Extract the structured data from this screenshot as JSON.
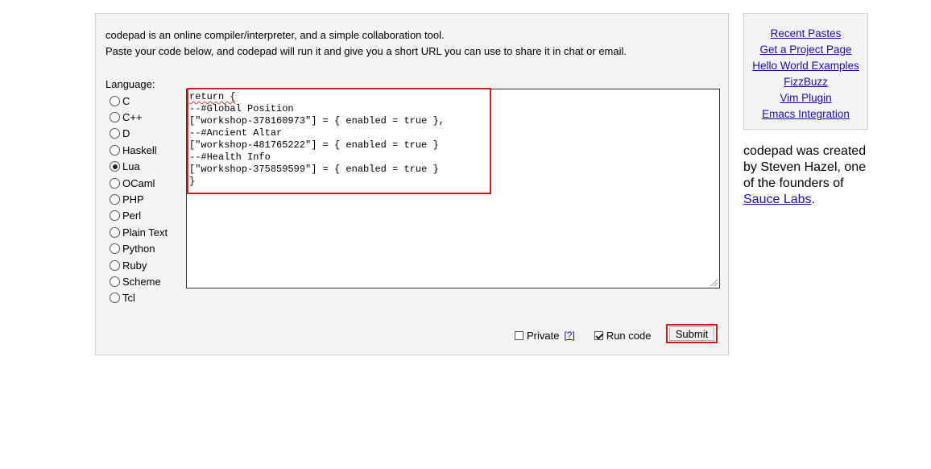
{
  "intro": {
    "line1": "codepad is an online compiler/interpreter, and a simple collaboration tool.",
    "line2": "Paste your code below, and codepad will run it and give you a short URL you can use to share it in chat or email."
  },
  "language": {
    "label": "Language:",
    "options": [
      "C",
      "C++",
      "D",
      "Haskell",
      "Lua",
      "OCaml",
      "PHP",
      "Perl",
      "Plain Text",
      "Python",
      "Ruby",
      "Scheme",
      "Tcl"
    ],
    "selected": "Lua"
  },
  "code": {
    "lines": [
      "return {",
      "--#Global Position",
      "[\"workshop-378160973\"] = { enabled = true },",
      "--#Ancient Altar",
      "[\"workshop-481765222\"] = { enabled = true }",
      "--#Health Info",
      "[\"workshop-375859599\"] = { enabled = true }",
      "}"
    ]
  },
  "controls": {
    "private_label": "Private",
    "private_checked": false,
    "help_link": "[?]",
    "run_label": "Run code",
    "run_checked": true,
    "submit_label": "Submit"
  },
  "sidebar": {
    "links": [
      "Recent Pastes",
      "Get a Project Page",
      "Hello World Examples",
      "FizzBuzz",
      "Vim Plugin",
      "Emacs Integration"
    ]
  },
  "about": {
    "text": "codepad was created by Steven Hazel, one of the founders of",
    "link": "Sauce Labs",
    "end": "."
  },
  "colors": {
    "highlight": "#cc1f1f",
    "link": "#1a0dab",
    "panel_bg": "#f4f4f4"
  }
}
